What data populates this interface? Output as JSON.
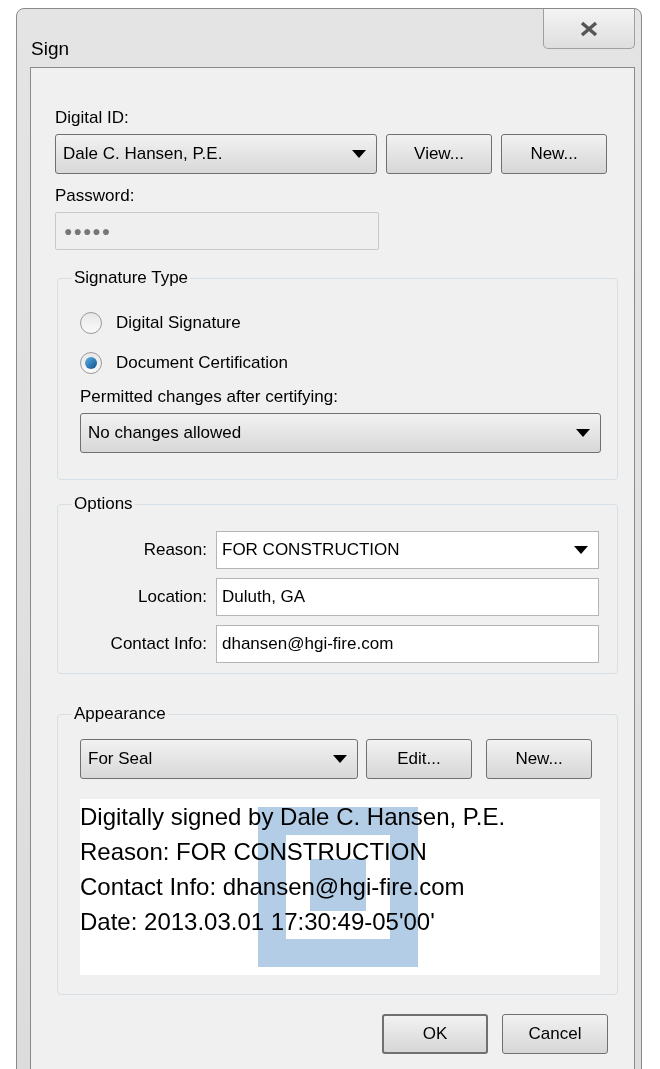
{
  "window": {
    "title": "Sign"
  },
  "digital_id": {
    "label": "Digital ID:",
    "value": "Dale C. Hansen, P.E.",
    "buttons": [
      "View...",
      "New..."
    ]
  },
  "password": {
    "label": "Password:",
    "value": "●●●●●",
    "disabled": true
  },
  "signature_type": {
    "title": "Signature Type",
    "options": [
      {
        "label": "Digital Signature",
        "selected": false
      },
      {
        "label": "Document Certification",
        "selected": true
      }
    ],
    "permitted_label": "Permitted changes after certifying:",
    "permitted_value": "No changes allowed"
  },
  "options": {
    "title": "Options",
    "rows": [
      {
        "label": "Reason:",
        "value": "FOR CONSTRUCTION",
        "kind": "dropdown"
      },
      {
        "label": "Location:",
        "value": "Duluth, GA",
        "kind": "text"
      },
      {
        "label": "Contact Info:",
        "value": "dhansen@hgi-fire.com",
        "kind": "text"
      }
    ]
  },
  "appearance": {
    "title": "Appearance",
    "value": "For Seal",
    "buttons": [
      "Edit...",
      "New..."
    ],
    "preview_lines": [
      "Digitally signed by Dale C. Hansen, P.E.",
      "Reason: FOR CONSTRUCTION",
      "Contact Info: dhansen@hgi-fire.com",
      "Date: 2013.03.01 17:30:49-05'00'"
    ]
  },
  "footer_buttons": [
    {
      "label": "OK",
      "default": true
    },
    {
      "label": "Cancel",
      "default": false
    }
  ]
}
